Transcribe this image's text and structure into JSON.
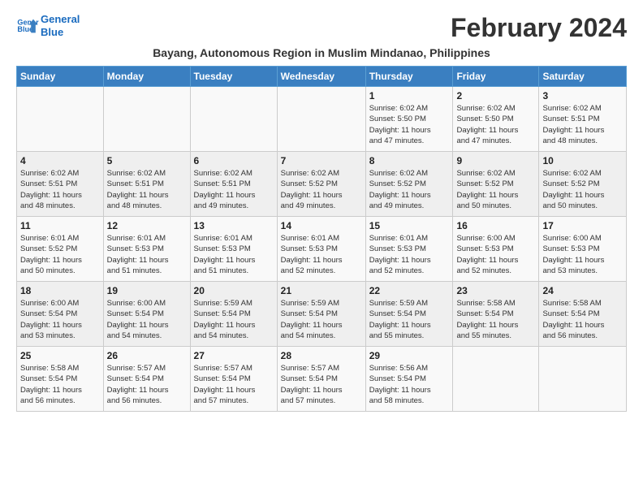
{
  "logo": {
    "line1": "General",
    "line2": "Blue"
  },
  "title": "February 2024",
  "location": "Bayang, Autonomous Region in Muslim Mindanao, Philippines",
  "weekdays": [
    "Sunday",
    "Monday",
    "Tuesday",
    "Wednesday",
    "Thursday",
    "Friday",
    "Saturday"
  ],
  "weeks": [
    [
      {
        "day": "",
        "info": ""
      },
      {
        "day": "",
        "info": ""
      },
      {
        "day": "",
        "info": ""
      },
      {
        "day": "",
        "info": ""
      },
      {
        "day": "1",
        "info": "Sunrise: 6:02 AM\nSunset: 5:50 PM\nDaylight: 11 hours\nand 47 minutes."
      },
      {
        "day": "2",
        "info": "Sunrise: 6:02 AM\nSunset: 5:50 PM\nDaylight: 11 hours\nand 47 minutes."
      },
      {
        "day": "3",
        "info": "Sunrise: 6:02 AM\nSunset: 5:51 PM\nDaylight: 11 hours\nand 48 minutes."
      }
    ],
    [
      {
        "day": "4",
        "info": "Sunrise: 6:02 AM\nSunset: 5:51 PM\nDaylight: 11 hours\nand 48 minutes."
      },
      {
        "day": "5",
        "info": "Sunrise: 6:02 AM\nSunset: 5:51 PM\nDaylight: 11 hours\nand 48 minutes."
      },
      {
        "day": "6",
        "info": "Sunrise: 6:02 AM\nSunset: 5:51 PM\nDaylight: 11 hours\nand 49 minutes."
      },
      {
        "day": "7",
        "info": "Sunrise: 6:02 AM\nSunset: 5:52 PM\nDaylight: 11 hours\nand 49 minutes."
      },
      {
        "day": "8",
        "info": "Sunrise: 6:02 AM\nSunset: 5:52 PM\nDaylight: 11 hours\nand 49 minutes."
      },
      {
        "day": "9",
        "info": "Sunrise: 6:02 AM\nSunset: 5:52 PM\nDaylight: 11 hours\nand 50 minutes."
      },
      {
        "day": "10",
        "info": "Sunrise: 6:02 AM\nSunset: 5:52 PM\nDaylight: 11 hours\nand 50 minutes."
      }
    ],
    [
      {
        "day": "11",
        "info": "Sunrise: 6:01 AM\nSunset: 5:52 PM\nDaylight: 11 hours\nand 50 minutes."
      },
      {
        "day": "12",
        "info": "Sunrise: 6:01 AM\nSunset: 5:53 PM\nDaylight: 11 hours\nand 51 minutes."
      },
      {
        "day": "13",
        "info": "Sunrise: 6:01 AM\nSunset: 5:53 PM\nDaylight: 11 hours\nand 51 minutes."
      },
      {
        "day": "14",
        "info": "Sunrise: 6:01 AM\nSunset: 5:53 PM\nDaylight: 11 hours\nand 52 minutes."
      },
      {
        "day": "15",
        "info": "Sunrise: 6:01 AM\nSunset: 5:53 PM\nDaylight: 11 hours\nand 52 minutes."
      },
      {
        "day": "16",
        "info": "Sunrise: 6:00 AM\nSunset: 5:53 PM\nDaylight: 11 hours\nand 52 minutes."
      },
      {
        "day": "17",
        "info": "Sunrise: 6:00 AM\nSunset: 5:53 PM\nDaylight: 11 hours\nand 53 minutes."
      }
    ],
    [
      {
        "day": "18",
        "info": "Sunrise: 6:00 AM\nSunset: 5:54 PM\nDaylight: 11 hours\nand 53 minutes."
      },
      {
        "day": "19",
        "info": "Sunrise: 6:00 AM\nSunset: 5:54 PM\nDaylight: 11 hours\nand 54 minutes."
      },
      {
        "day": "20",
        "info": "Sunrise: 5:59 AM\nSunset: 5:54 PM\nDaylight: 11 hours\nand 54 minutes."
      },
      {
        "day": "21",
        "info": "Sunrise: 5:59 AM\nSunset: 5:54 PM\nDaylight: 11 hours\nand 54 minutes."
      },
      {
        "day": "22",
        "info": "Sunrise: 5:59 AM\nSunset: 5:54 PM\nDaylight: 11 hours\nand 55 minutes."
      },
      {
        "day": "23",
        "info": "Sunrise: 5:58 AM\nSunset: 5:54 PM\nDaylight: 11 hours\nand 55 minutes."
      },
      {
        "day": "24",
        "info": "Sunrise: 5:58 AM\nSunset: 5:54 PM\nDaylight: 11 hours\nand 56 minutes."
      }
    ],
    [
      {
        "day": "25",
        "info": "Sunrise: 5:58 AM\nSunset: 5:54 PM\nDaylight: 11 hours\nand 56 minutes."
      },
      {
        "day": "26",
        "info": "Sunrise: 5:57 AM\nSunset: 5:54 PM\nDaylight: 11 hours\nand 56 minutes."
      },
      {
        "day": "27",
        "info": "Sunrise: 5:57 AM\nSunset: 5:54 PM\nDaylight: 11 hours\nand 57 minutes."
      },
      {
        "day": "28",
        "info": "Sunrise: 5:57 AM\nSunset: 5:54 PM\nDaylight: 11 hours\nand 57 minutes."
      },
      {
        "day": "29",
        "info": "Sunrise: 5:56 AM\nSunset: 5:54 PM\nDaylight: 11 hours\nand 58 minutes."
      },
      {
        "day": "",
        "info": ""
      },
      {
        "day": "",
        "info": ""
      }
    ]
  ]
}
